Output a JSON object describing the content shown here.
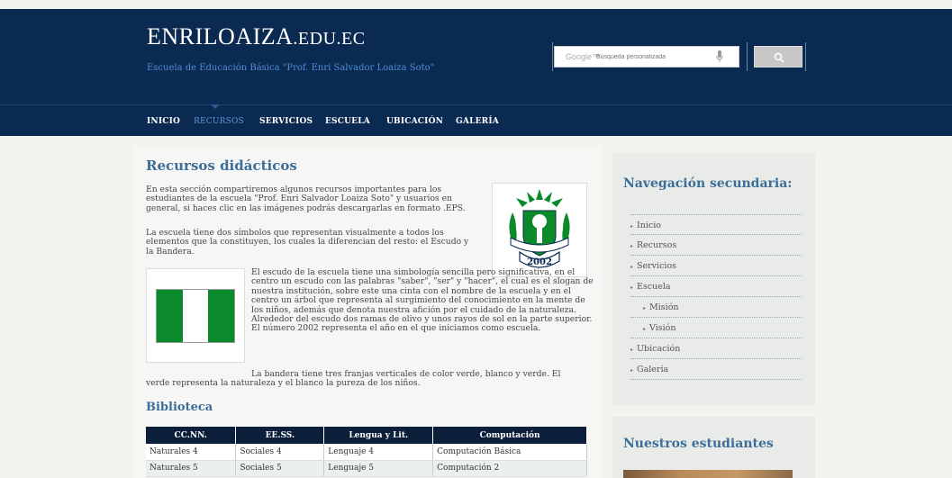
{
  "header": {
    "logo_main": "ENRILOAIZA",
    "logo_suffix": ".EDU.EC",
    "subtitle": "Escuela de Educación Básica \"Prof. Enri Salvador Loaiza Soto\"",
    "search": {
      "brand": "Google™",
      "placeholder": "Búsqueda personalizada"
    }
  },
  "nav": {
    "items": [
      "INICIO",
      "RECURSOS",
      "SERVICIOS",
      "ESCUELA",
      "UBICACIÓN",
      "GALERÍA"
    ],
    "active": "RECURSOS"
  },
  "main": {
    "title": "Recursos didácticos",
    "p1": "En esta sección compartiremos algunos recursos importantes para los estudiantes de la escuela \"Prof. Enri Salvador Loaiza Soto\" y usuarios en general, si haces clic en las imágenes podrás descargarlas en formato .EPS.",
    "p2": "La escuela tiene dos símbolos que representan visualmente a todos los elementos que la constituyen, los cuales la diferencian del resto: el Escudo y la Bandera.",
    "p3": "El escudo de la escuela tiene una simbología sencilla pero significativa, en el centro un escudo con las palabras \"saber\", \"ser\" y \"hacer\", el cual es el slogan de nuestra institución, sobre este una cinta con el nombre de la escuela y en el centro un árbol que representa al surgimiento del conocimiento en la mente de los niños, además que denota nuestra afición por el cuidado de la naturaleza. Alrededor del escudo dos ramas de olivo y unos rayos de sol en la parte superior. El número 2002 representa el año en el que iniciamos como escuela.",
    "p4a": "La bandera tiene tres franjas verticales de color verde, blanco y verde. El",
    "p4b": "verde representa la naturaleza y el blanco la pureza de los niños.",
    "escudo_year": "2002",
    "flag_colors": [
      "#0a8a2a",
      "#ffffff",
      "#0a8a2a"
    ]
  },
  "biblioteca": {
    "title": "Biblioteca",
    "columns": [
      "CC.NN.",
      "EE.SS.",
      "Lengua y Lit.",
      "Computación"
    ],
    "rows": [
      [
        "Naturales 4",
        "Sociales 4",
        "Lenguaje 4",
        "Computación Básica"
      ],
      [
        "Naturales 5",
        "Sociales 5",
        "Lenguaje 5",
        "Computación 2"
      ]
    ]
  },
  "sidebar": {
    "title": "Navegación secundaria:",
    "items": [
      {
        "label": "Inicio",
        "sub": false
      },
      {
        "label": "Recursos",
        "sub": false
      },
      {
        "label": "Servicios",
        "sub": false
      },
      {
        "label": "Escuela",
        "sub": false
      },
      {
        "label": "Misión",
        "sub": true
      },
      {
        "label": "Visión",
        "sub": true
      },
      {
        "label": "Ubicación",
        "sub": false
      },
      {
        "label": "Galería",
        "sub": false
      }
    ],
    "students_title": "Nuestros estudiantes"
  },
  "colors": {
    "header_bg": "#0b2a52",
    "accent": "#3c6e9a",
    "active_nav": "#5e97d8"
  }
}
